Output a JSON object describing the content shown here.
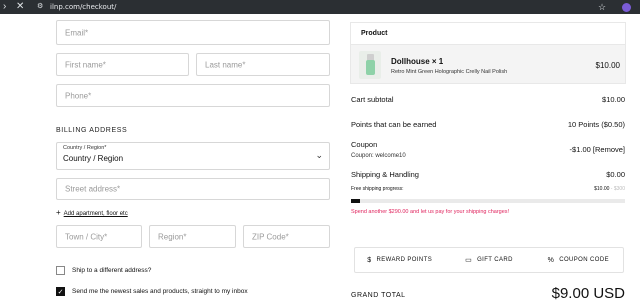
{
  "browser": {
    "url": "ilnp.com/checkout/"
  },
  "form": {
    "email_placeholder": "Email*",
    "first_name_placeholder": "First name*",
    "last_name_placeholder": "Last name*",
    "phone_placeholder": "Phone*",
    "billing_title": "BILLING ADDRESS",
    "country_label": "Country / Region*",
    "country_value": "Country / Region",
    "street_placeholder": "Street address*",
    "add_apartment_link": "Add apartment, floor etc",
    "town_placeholder": "Town / City*",
    "region_placeholder": "Region*",
    "zip_placeholder": "ZIP Code*",
    "ship_different_label": "Ship to a different address?",
    "newsletter_label": "Send me the newest sales and products, straight to my inbox",
    "ship_different_checked": false,
    "newsletter_checked": true
  },
  "order": {
    "product_header": "Product",
    "product_name": "Dollhouse × 1",
    "product_desc": "Retro Mint Green Holographic Crelly Nail Polish",
    "product_price": "$10.00",
    "cart_subtotal_label": "Cart subtotal",
    "cart_subtotal_value": "$10.00",
    "points_label": "Points that can be earned",
    "points_value": "10 Points ($0.50)",
    "coupon_label": "Coupon",
    "coupon_code_text": "Coupon: welcome10",
    "coupon_value": "-$1.00 [Remove]",
    "shipping_label": "Shipping & Handling",
    "shipping_value": "$0.00",
    "free_ship_label": "Free shipping progress:",
    "free_ship_current": "$10.00",
    "free_ship_sep": " - ",
    "free_ship_target": "$300",
    "free_ship_progress": 0.0333,
    "promo_text": "Spend another $290.00 and let us pay for your shipping charges!",
    "tabs": [
      {
        "label": "REWARD POINTS",
        "icon": "$"
      },
      {
        "label": "GIFT CARD",
        "icon": "▭"
      },
      {
        "label": "COUPON CODE",
        "icon": "%"
      }
    ],
    "grand_total_label": "GRAND TOTAL",
    "grand_total_value": "$9.00 USD"
  }
}
